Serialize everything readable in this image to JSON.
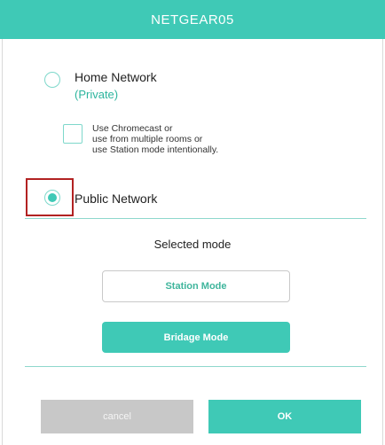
{
  "dialog": {
    "title": "NETGEAR05"
  },
  "options": {
    "home_network": {
      "label": "Home Network",
      "sublabel": "(Private)",
      "selected": false
    },
    "chromecast": {
      "line1": "Use Chromecast or",
      "line2": "use from multiple rooms or",
      "line3": "use Station mode intentionally.",
      "checked": false
    },
    "public_network": {
      "label": "Public Network",
      "selected": true
    }
  },
  "mode": {
    "heading": "Selected mode",
    "station_label": "Station Mode",
    "bridge_label": "Bridage Mode"
  },
  "footer": {
    "cancel_label": "cancel",
    "ok_label": "OK"
  },
  "colors": {
    "accent": "#3fc9b6",
    "accent_text": "#2db59e",
    "highlight": "#b22222",
    "disabled": "#c8c8c8"
  }
}
